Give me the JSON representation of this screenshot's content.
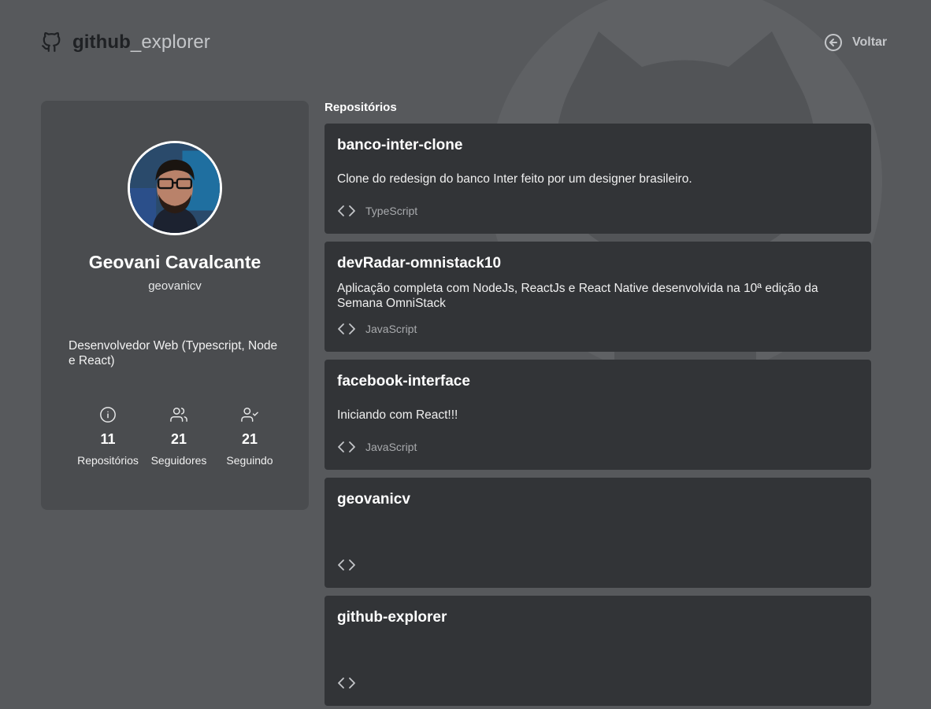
{
  "header": {
    "logo_prefix": "github",
    "logo_suffix": "_explorer",
    "back_label": "Voltar"
  },
  "profile": {
    "name": "Geovani Cavalcante",
    "login": "geovanicv",
    "bio": "Desenvolvedor Web (Typescript, Node e React)",
    "stats": [
      {
        "icon": "info-icon",
        "count": "11",
        "label": "Repositórios"
      },
      {
        "icon": "users-icon",
        "count": "21",
        "label": "Seguidores"
      },
      {
        "icon": "user-check-icon",
        "count": "21",
        "label": "Seguindo"
      }
    ]
  },
  "repos": {
    "title": "Repositórios",
    "items": [
      {
        "name": "banco-inter-clone",
        "description": "Clone do redesign do banco Inter feito por um designer brasileiro.",
        "language": "TypeScript"
      },
      {
        "name": "devRadar-omnistack10",
        "description": "Aplicação completa com NodeJs, ReactJs e React Native desenvolvida na 10ª edição da Semana OmniStack",
        "language": "JavaScript"
      },
      {
        "name": "facebook-interface",
        "description": "Iniciando com React!!!",
        "language": "JavaScript"
      },
      {
        "name": "geovanicv",
        "description": "",
        "language": ""
      },
      {
        "name": "github-explorer",
        "description": "",
        "language": ""
      }
    ]
  },
  "colors": {
    "background": "#57595c",
    "card": "#4a4c4f",
    "repo_card": "#323437",
    "muted_text": "#a8aaad"
  }
}
